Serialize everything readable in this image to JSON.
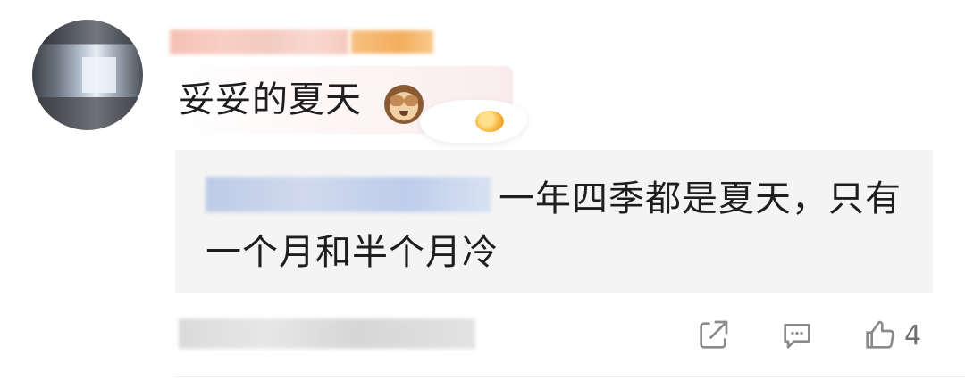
{
  "comment": {
    "text": "妥妥的夏天",
    "emoji_name": "see-no-evil-monkey-icon",
    "sticker_name": "fried-egg-icon"
  },
  "reply": {
    "line1": "一年四季都是夏天，只有",
    "line2": "一个月和半个月冷"
  },
  "actions": {
    "share_icon": "share-icon",
    "reply_icon": "comment-icon",
    "like_icon": "thumbs-up-icon",
    "like_count": "4"
  },
  "colors": {
    "reply_bg": "#f4f4f4",
    "icon_gray": "#8a8a8a"
  }
}
